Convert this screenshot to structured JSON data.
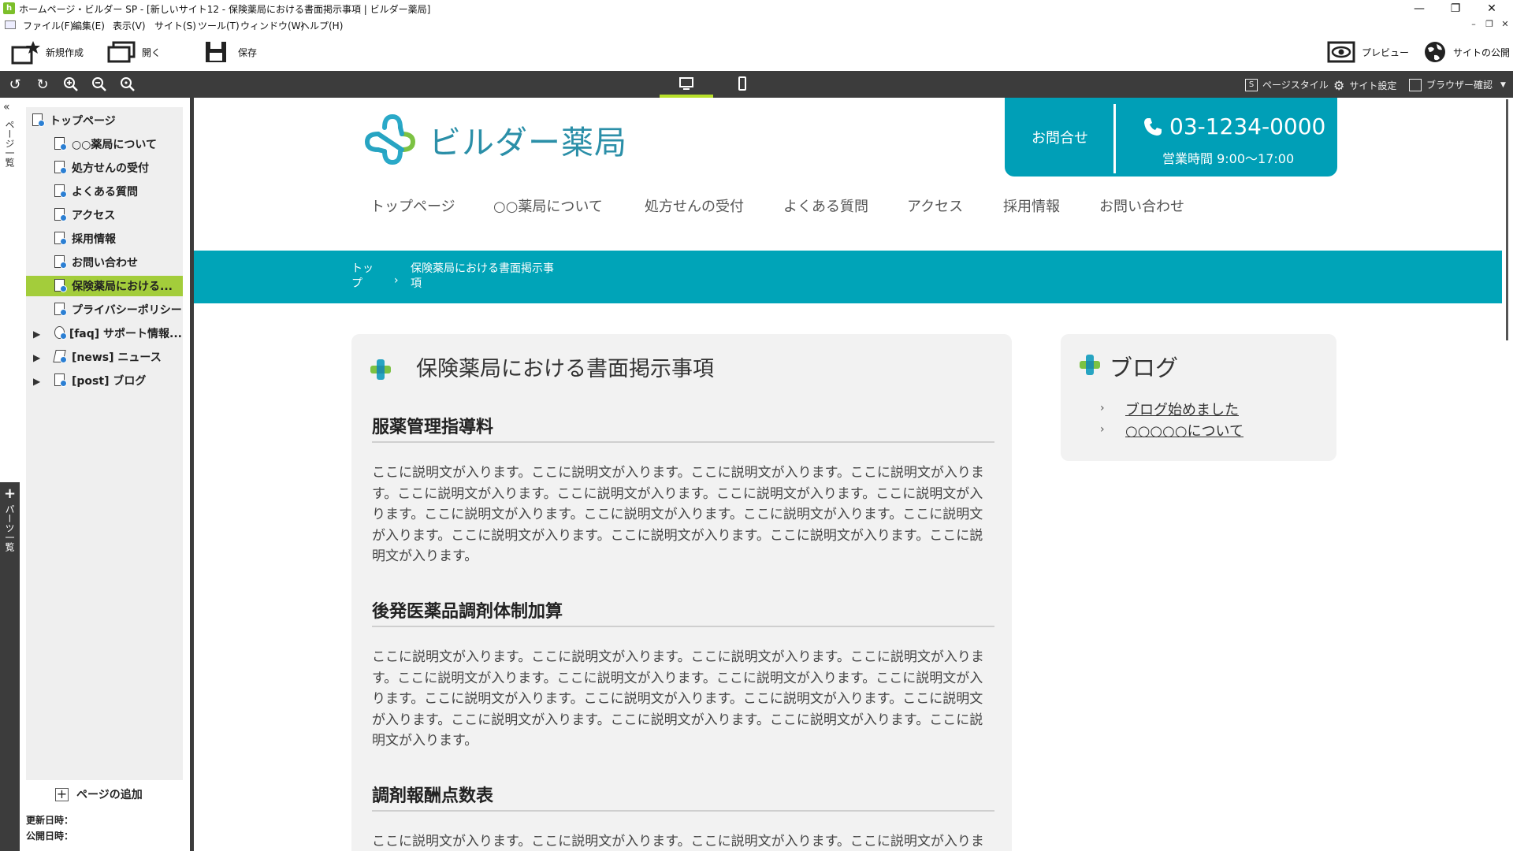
{
  "window": {
    "title": "ホームページ・ビルダー SP - [新しいサイト12 - 保険薬局における書面掲示事項 | ビルダー薬局]",
    "app_icon": "h",
    "minimize": "—",
    "maximize": "❐",
    "close": "✕"
  },
  "menu": {
    "items": [
      "ファイル(F)",
      "編集(E)",
      "表示(V)",
      "サイト(S)",
      "ツール(T)",
      "ウィンドウ(W)",
      "ヘルプ(H)"
    ],
    "mdi_controls": [
      "–",
      "❐",
      "✕"
    ]
  },
  "toolbar": {
    "new_label": "新規作成",
    "open_label": "開く",
    "save_label": "保存",
    "preview_label": "プレビュー",
    "publish_label": "サイトの公開"
  },
  "darkbar": {
    "page_style": "ページスタイル",
    "site_settings": "サイト設定",
    "browser_check": "ブラウザー確認",
    "page_style_glyph": "S"
  },
  "side_tabs": {
    "page_list": "ページ一覧",
    "parts_list": "パーツ一覧",
    "collapse": "«",
    "parts_plus": "+"
  },
  "tree": {
    "root": "トップページ",
    "pages": [
      "○○薬局について",
      "処方せんの受付",
      "よくある質問",
      "アクセス",
      "採用情報",
      "お問い合わせ",
      "保険薬局における...",
      "プライバシーポリシー"
    ],
    "selected_index": 6,
    "groups": [
      "[faq] サポート情報...",
      "[news] ニュース",
      "[post] ブログ"
    ],
    "add_page": "ページの追加",
    "updated": "更新日時：",
    "published": "公開日時："
  },
  "site": {
    "logo_text": "ビルダー薬局",
    "contact_label": "お問合せ",
    "phone": "03-1234-0000",
    "hours": "営業時間 9:00〜17:00",
    "nav": [
      "トップページ",
      "○○薬局について",
      "処方せんの受付",
      "よくある質問",
      "アクセス",
      "採用情報",
      "お問い合わせ"
    ],
    "breadcrumb_home": "トップ",
    "breadcrumb_sep": "›",
    "breadcrumb_current": "保険薬局における書面掲示事項",
    "page_title": "保険薬局における書面掲示事項",
    "sections": [
      {
        "heading": "服薬管理指導料",
        "body": "ここに説明文が入ります。ここに説明文が入ります。ここに説明文が入ります。ここに説明文が入ります。ここに説明文が入ります。ここに説明文が入ります。ここに説明文が入ります。ここに説明文が入ります。ここに説明文が入ります。ここに説明文が入ります。ここに説明文が入ります。ここに説明文が入ります。ここに説明文が入ります。ここに説明文が入ります。ここに説明文が入ります。ここに説明文が入ります。"
      },
      {
        "heading": "後発医薬品調剤体制加算",
        "body": "ここに説明文が入ります。ここに説明文が入ります。ここに説明文が入ります。ここに説明文が入ります。ここに説明文が入ります。ここに説明文が入ります。ここに説明文が入ります。ここに説明文が入ります。ここに説明文が入ります。ここに説明文が入ります。ここに説明文が入ります。ここに説明文が入ります。ここに説明文が入ります。ここに説明文が入ります。ここに説明文が入ります。ここに説明文が入ります。"
      },
      {
        "heading": "調剤報酬点数表",
        "body": "ここに説明文が入ります。ここに説明文が入ります。ここに説明文が入ります。ここに説明文が入ります。"
      }
    ],
    "blog_title": "ブログ",
    "blog_items": [
      "ブログ始めました",
      "○○○○○について"
    ],
    "blog_arrow": "›"
  },
  "colors": {
    "accent": "#009fb7",
    "selected": "#a3cd3b",
    "device_active": "#b8e02a",
    "dark": "#3c3c3c"
  },
  "icons": [
    "new-page-icon",
    "open-icon",
    "save-icon",
    "preview-eye-icon",
    "publish-globe-icon",
    "undo-icon",
    "redo-icon",
    "zoom-in-icon",
    "zoom-out-icon",
    "zoom-reset-icon",
    "desktop-icon",
    "mobile-icon",
    "gear-icon",
    "phone-icon",
    "cross-plus-icon"
  ]
}
